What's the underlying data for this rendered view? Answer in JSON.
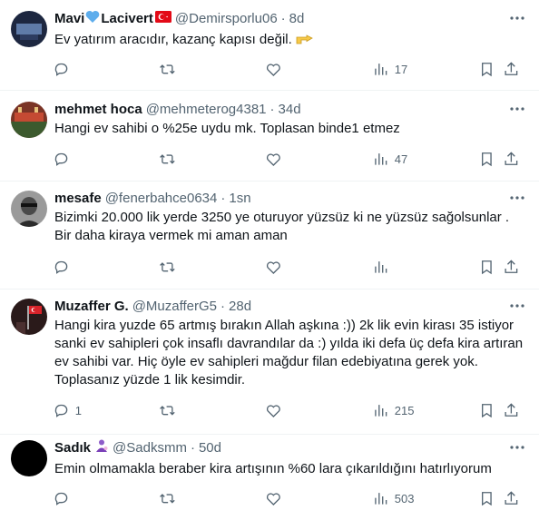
{
  "tweets": [
    {
      "name": "Mavi",
      "name_suffix": "Lacivert",
      "handle": "@Demirsporlu06",
      "time": "8d",
      "text": "Ev yatırım aracıdır, kazanç kapısı değil.",
      "reply_count": "",
      "views": "17",
      "avatar_color": "#1d2740",
      "emoji_after_name": "blue-heart-icon",
      "flag": "turkey-flag-icon"
    },
    {
      "name": "mehmet hoca",
      "handle": "@mehmeterog4381",
      "time": "34d",
      "text": "Hangi ev sahibi o %25e uydu mk. Toplasan binde1 etmez",
      "reply_count": "",
      "views": "47",
      "avatar_color": "#8b3a2a"
    },
    {
      "name": "mesafe",
      "handle": "@fenerbahce0634",
      "time": "1sn",
      "text": "Bizimki 20.000 lik yerde 3250 ye oturuyor yüzsüz ki ne yüzsüz sağolsunlar . Bir daha kiraya vermek mi aman aman",
      "reply_count": "",
      "views": "",
      "avatar_color": "#6b6b6b"
    },
    {
      "name": "Muzaffer G.",
      "handle": "@MuzafferG5",
      "time": "28d",
      "text": "Hangi kira yuzde 65 artmış bırakın Allah aşkına :)) 2k lik evin kirası 35 istiyor sanki ev sahipleri çok insaflı davrandılar da :) yılda iki defa üç defa kira artıran ev sahibi var. Hiç öyle ev sahipleri mağdur filan edebiyatına gerek yok. Toplasanız yüzde 1 lik kesimdir.",
      "reply_count": "1",
      "views": "215",
      "avatar_color": "#3a1f1f"
    },
    {
      "name": "Sadık",
      "handle": "@Sadksmm",
      "time": "50d",
      "text": "Emin olmamakla beraber kira artışının %60 lara çıkarıldığını hatırlıyorum",
      "reply_count": "",
      "views": "503",
      "avatar_color": "#000000",
      "emoji_after_name": "person-emoji-icon"
    }
  ],
  "colors": {
    "accent": "#1d9bf0",
    "muted": "#536471",
    "text": "#0f1419",
    "divider": "#eff3f4"
  }
}
